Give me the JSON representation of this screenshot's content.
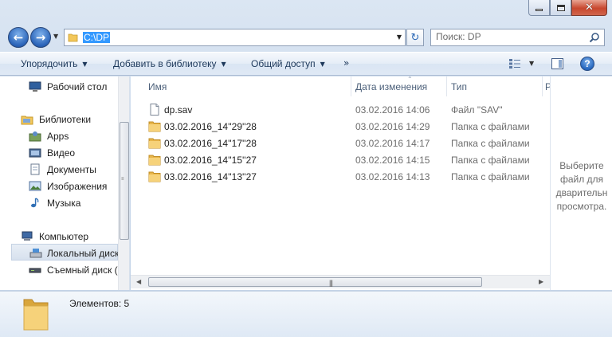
{
  "address": {
    "path": "C:\\DP"
  },
  "search": {
    "placeholder": "Поиск: DP"
  },
  "toolbar": {
    "organize": "Упорядочить",
    "add_to_library": "Добавить в библиотеку",
    "share": "Общий доступ",
    "more": "»",
    "help": "?"
  },
  "sidebar": {
    "items": [
      {
        "label": "Рабочий стол",
        "icon": "desktop-icon"
      },
      {
        "label": "Библиотеки",
        "icon": "libraries-icon"
      },
      {
        "label": "Apps",
        "icon": "apps-icon"
      },
      {
        "label": "Видео",
        "icon": "video-icon"
      },
      {
        "label": "Документы",
        "icon": "documents-icon"
      },
      {
        "label": "Изображения",
        "icon": "pictures-icon"
      },
      {
        "label": "Музыка",
        "icon": "music-icon"
      },
      {
        "label": "Компьютер",
        "icon": "computer-icon"
      },
      {
        "label": "Локальный диск",
        "icon": "local-disk-icon"
      },
      {
        "label": "Съемный диск (",
        "icon": "removable-disk-icon"
      }
    ]
  },
  "columns": {
    "name": "Имя",
    "date": "Дата изменения",
    "type": "Тип",
    "size": "Р"
  },
  "files": [
    {
      "name": "dp.sav",
      "date": "03.02.2016 14:06",
      "type": "Файл \"SAV\"",
      "icon": "file-icon"
    },
    {
      "name": "03.02.2016_14''29''28",
      "date": "03.02.2016 14:29",
      "type": "Папка с файлами",
      "icon": "folder-icon"
    },
    {
      "name": "03.02.2016_14''17''28",
      "date": "03.02.2016 14:17",
      "type": "Папка с файлами",
      "icon": "folder-icon"
    },
    {
      "name": "03.02.2016_14''15''27",
      "date": "03.02.2016 14:15",
      "type": "Папка с файлами",
      "icon": "folder-icon"
    },
    {
      "name": "03.02.2016_14''13''27",
      "date": "03.02.2016 14:13",
      "type": "Папка с файлами",
      "icon": "folder-icon"
    }
  ],
  "preview": {
    "line1": "Выберите",
    "line2": "файл для",
    "line3": "дварительн",
    "line4": "просмотра."
  },
  "details": {
    "count": "Элементов: 5"
  },
  "colors": {
    "accent": "#3399ff",
    "folder": "#f3c75a",
    "close": "#c8472e"
  }
}
